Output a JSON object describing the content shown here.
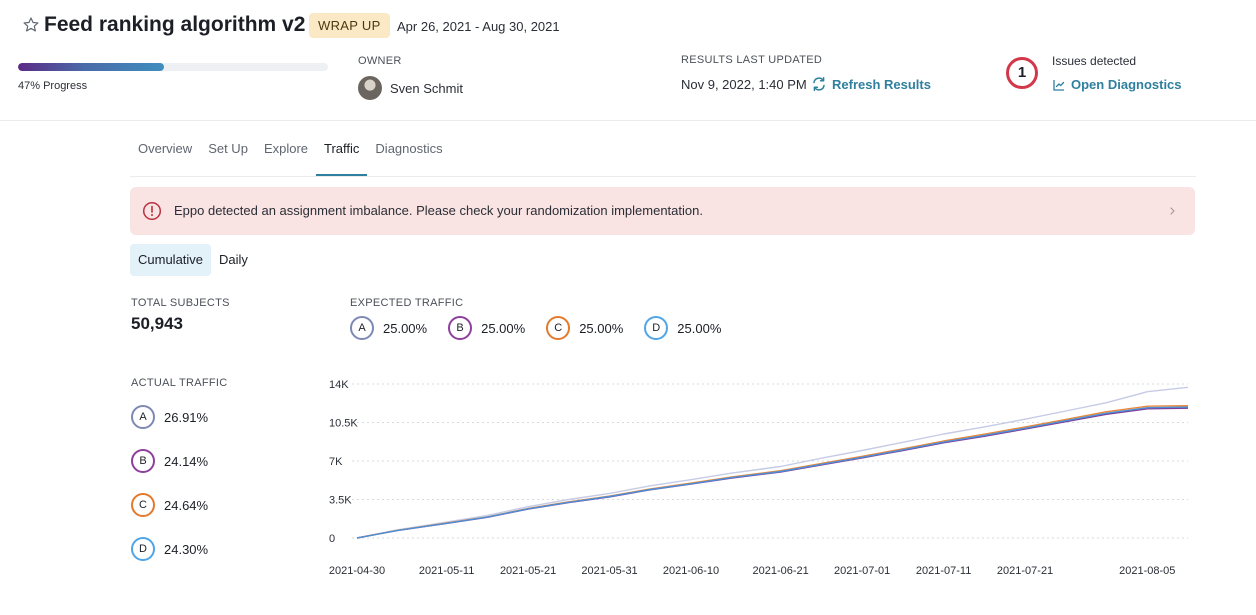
{
  "header": {
    "title": "Feed ranking algorithm v2",
    "status": "WRAP UP",
    "date_range": "Apr 26, 2021 - Aug 30, 2021",
    "progress": {
      "percent": 47,
      "label": "47% Progress"
    },
    "owner": {
      "heading": "OWNER",
      "name": "Sven Schmit"
    },
    "results": {
      "heading": "RESULTS LAST UPDATED",
      "time": "Nov 9, 2022, 1:40 PM",
      "refresh_label": "Refresh Results"
    },
    "issues": {
      "count": "1",
      "label": "Issues detected",
      "link_label": "Open Diagnostics"
    },
    "colors": {
      "accent": "#2f7f9f",
      "issue_ring": "#d2384a",
      "badge_bg": "#fbe9c5"
    }
  },
  "tabs": [
    {
      "label": "Overview",
      "active": false
    },
    {
      "label": "Set Up",
      "active": false
    },
    {
      "label": "Explore",
      "active": false
    },
    {
      "label": "Traffic",
      "active": true
    },
    {
      "label": "Diagnostics",
      "active": false
    }
  ],
  "alert": {
    "text": "Eppo detected an assignment imbalance. Please check your randomization implementation.",
    "color": "#f9e3e3"
  },
  "view_toggle": {
    "options": [
      "Cumulative",
      "Daily"
    ],
    "selected": "Cumulative"
  },
  "stats": {
    "total_label": "TOTAL SUBJECTS",
    "total_value": "50,943",
    "expected_label": "EXPECTED TRAFFIC",
    "actual_label": "ACTUAL TRAFFIC",
    "variants": [
      {
        "letter": "A",
        "expected": "25.00%",
        "actual": "26.91%",
        "color": "#7d89b4"
      },
      {
        "letter": "B",
        "expected": "25.00%",
        "actual": "24.14%",
        "color": "#8e3f9c"
      },
      {
        "letter": "C",
        "expected": "25.00%",
        "actual": "24.64%",
        "color": "#e37a2c"
      },
      {
        "letter": "D",
        "expected": "25.00%",
        "actual": "24.30%",
        "color": "#4fa5e6"
      }
    ]
  },
  "chart_data": {
    "type": "line",
    "title": "",
    "xlabel": "",
    "ylabel": "",
    "ylim": [
      0,
      14000
    ],
    "yticks": [
      0,
      3500,
      7000,
      10500,
      14000
    ],
    "ytick_labels": [
      "0",
      "3.5K",
      "7K",
      "10.5K",
      "14K"
    ],
    "xtick_labels": [
      "2021-04-30",
      "2021-05-11",
      "2021-05-21",
      "2021-05-31",
      "2021-06-10",
      "2021-06-21",
      "2021-07-01",
      "2021-07-11",
      "2021-07-21",
      "2021-08-05"
    ],
    "xtick_dates": [
      "2021-04-30",
      "2021-05-11",
      "2021-05-21",
      "2021-05-31",
      "2021-06-10",
      "2021-06-21",
      "2021-07-01",
      "2021-07-11",
      "2021-07-21",
      "2021-08-05"
    ],
    "grid": "horizontal dotted",
    "x": [
      "2021-04-30",
      "2021-05-05",
      "2021-05-11",
      "2021-05-16",
      "2021-05-21",
      "2021-05-26",
      "2021-05-31",
      "2021-06-05",
      "2021-06-10",
      "2021-06-15",
      "2021-06-21",
      "2021-06-26",
      "2021-07-01",
      "2021-07-06",
      "2021-07-11",
      "2021-07-16",
      "2021-07-21",
      "2021-07-26",
      "2021-07-31",
      "2021-08-05",
      "2021-08-10"
    ],
    "series": [
      {
        "name": "A",
        "color": "#c6cbe6",
        "values": [
          0,
          750,
          1450,
          2050,
          2850,
          3500,
          4050,
          4750,
          5300,
          5900,
          6500,
          7250,
          7950,
          8700,
          9450,
          10100,
          10800,
          11550,
          12300,
          13300,
          13700
        ]
      },
      {
        "name": "B",
        "color": "#7b3f9a",
        "values": [
          0,
          690,
          1330,
          1880,
          2630,
          3230,
          3740,
          4380,
          4900,
          5450,
          6000,
          6650,
          7280,
          7950,
          8650,
          9250,
          9900,
          10570,
          11250,
          11750,
          11800
        ]
      },
      {
        "name": "C",
        "color": "#e98a3a",
        "values": [
          0,
          700,
          1360,
          1920,
          2680,
          3290,
          3810,
          4460,
          4990,
          5550,
          6120,
          6780,
          7430,
          8110,
          8820,
          9440,
          10100,
          10780,
          11480,
          11980,
          12030
        ]
      },
      {
        "name": "D",
        "color": "#4d8fd6",
        "values": [
          0,
          695,
          1340,
          1900,
          2650,
          3250,
          3770,
          4410,
          4930,
          5490,
          6050,
          6700,
          7340,
          8020,
          8720,
          9330,
          9980,
          10660,
          11350,
          11850,
          11900
        ]
      }
    ]
  }
}
